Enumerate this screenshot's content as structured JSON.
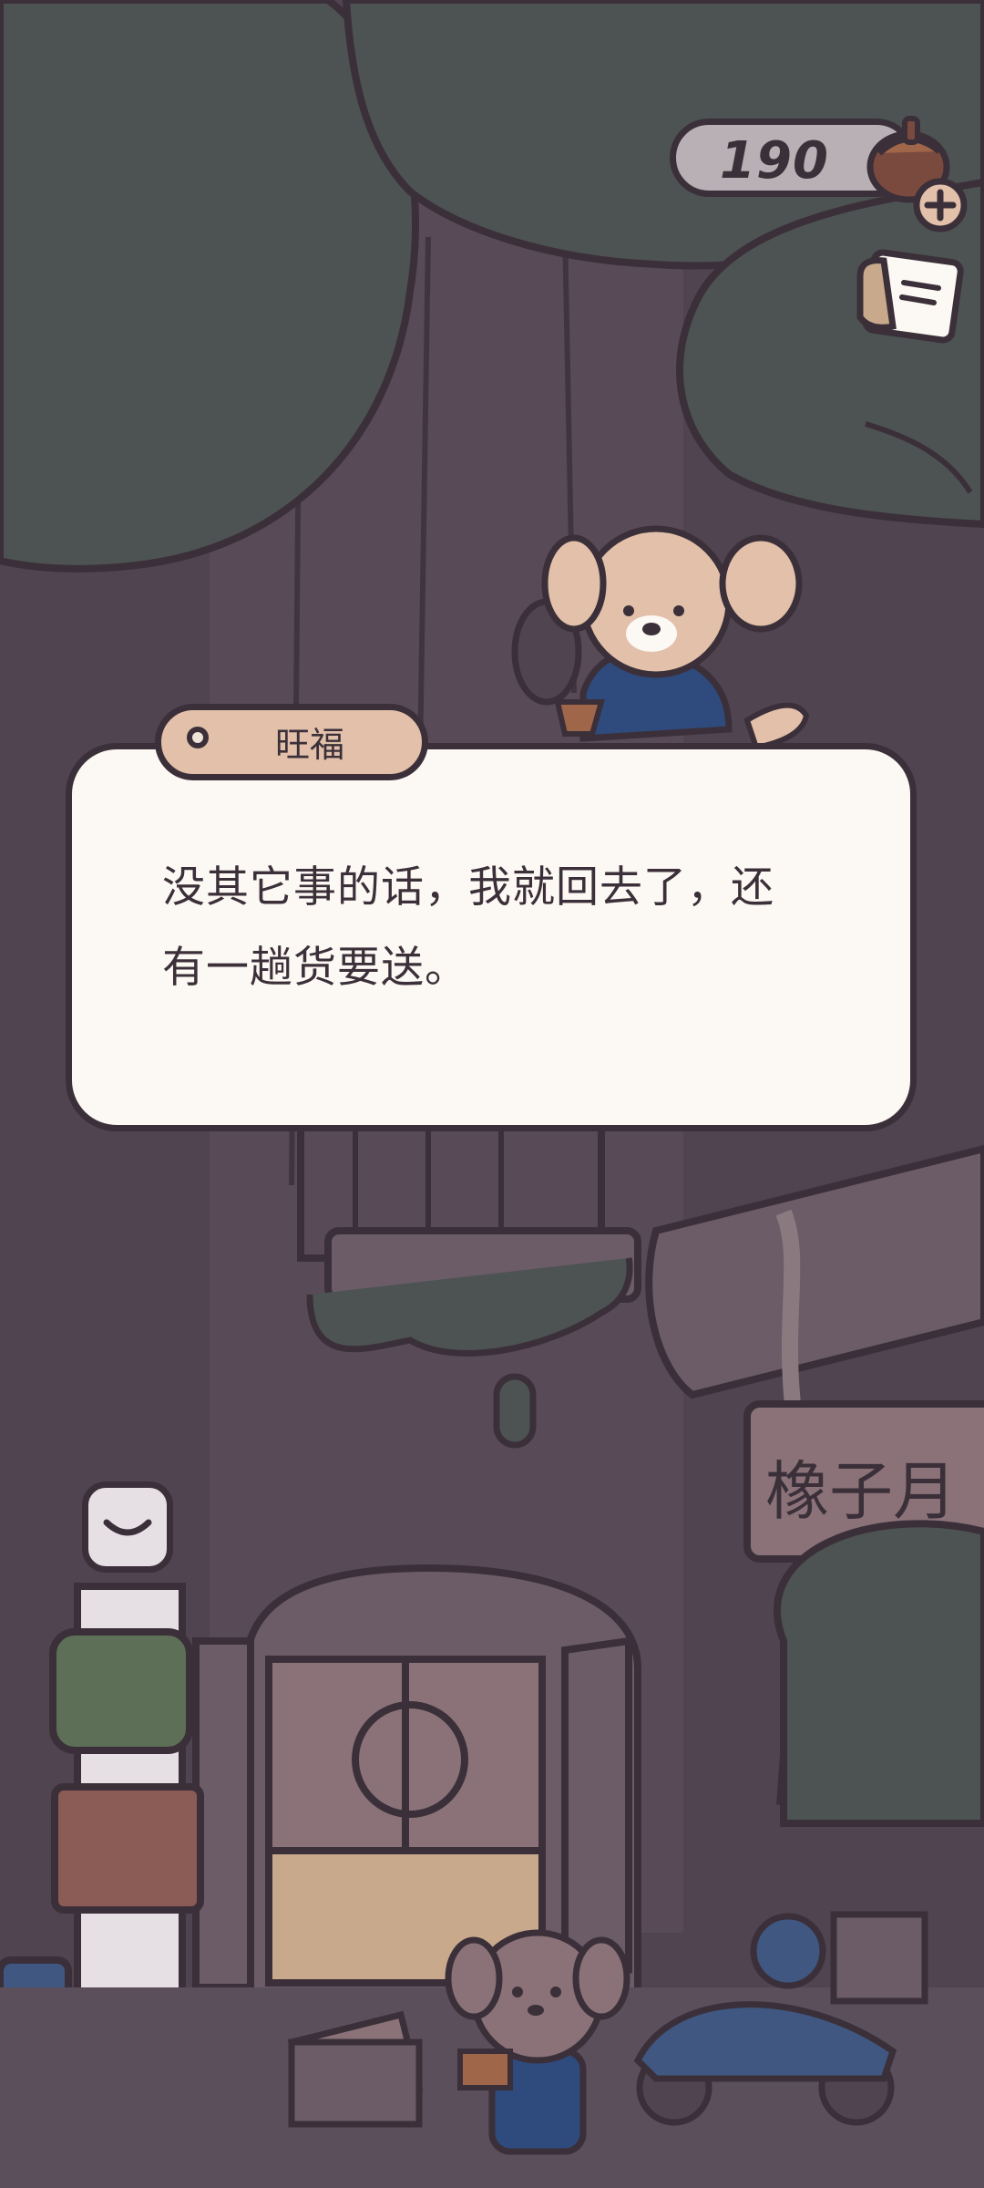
{
  "hud": {
    "currency_value": "190",
    "currency_icon": "acorn-icon",
    "add_icon": "plus-icon",
    "quest_icon": "note-card-icon"
  },
  "dialog": {
    "speaker": "旺福",
    "text": "没其它事的话，我就回去了，还\n有一趟货要送。"
  },
  "scene": {
    "sign_text": "橡子月",
    "collapse_icon": "chevron-down-icon"
  },
  "colors": {
    "outline": "#3b3039",
    "bg": "#4f4450",
    "foliage": "#4d5352",
    "dialog_bg": "#fcf8f3",
    "tag_bg": "#e2c0aa"
  }
}
